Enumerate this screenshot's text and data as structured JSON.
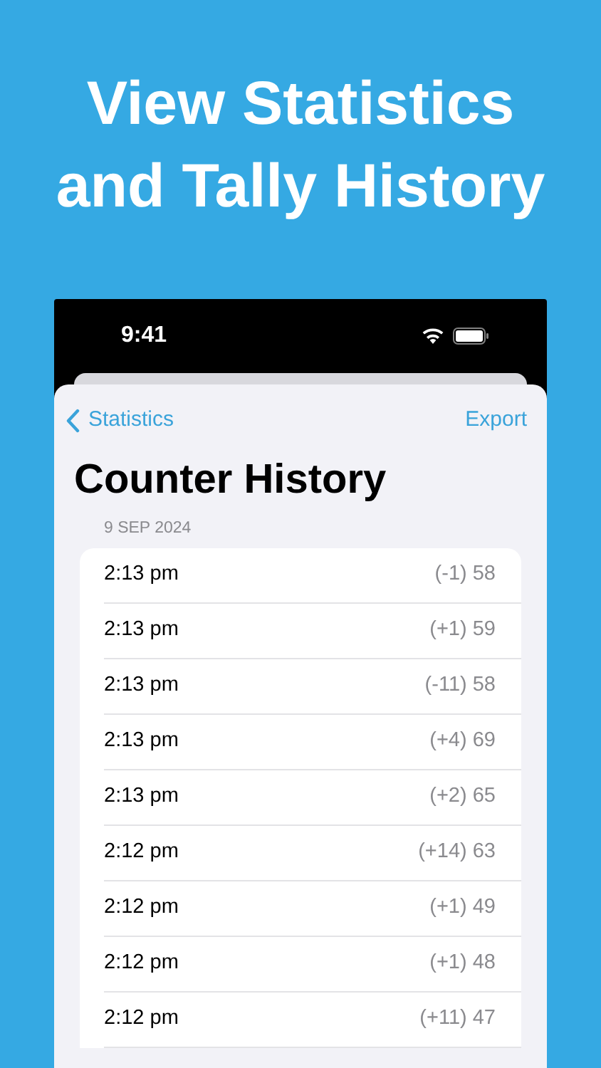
{
  "headline": [
    "View Statistics",
    "and Tally History"
  ],
  "status_bar": {
    "time": "9:41"
  },
  "nav": {
    "back": "Statistics",
    "action": "Export"
  },
  "title": "Counter History",
  "section": {
    "date": "9 SEP 2024",
    "rows": [
      {
        "time": "2:13 pm",
        "change": "(-1) 58"
      },
      {
        "time": "2:13 pm",
        "change": "(+1) 59"
      },
      {
        "time": "2:13 pm",
        "change": "(-11) 58"
      },
      {
        "time": "2:13 pm",
        "change": "(+4) 69"
      },
      {
        "time": "2:13 pm",
        "change": "(+2) 65"
      },
      {
        "time": "2:12 pm",
        "change": "(+14) 63"
      },
      {
        "time": "2:12 pm",
        "change": "(+1) 49"
      },
      {
        "time": "2:12 pm",
        "change": "(+1) 48"
      },
      {
        "time": "2:12 pm",
        "change": "(+11) 47"
      }
    ]
  }
}
